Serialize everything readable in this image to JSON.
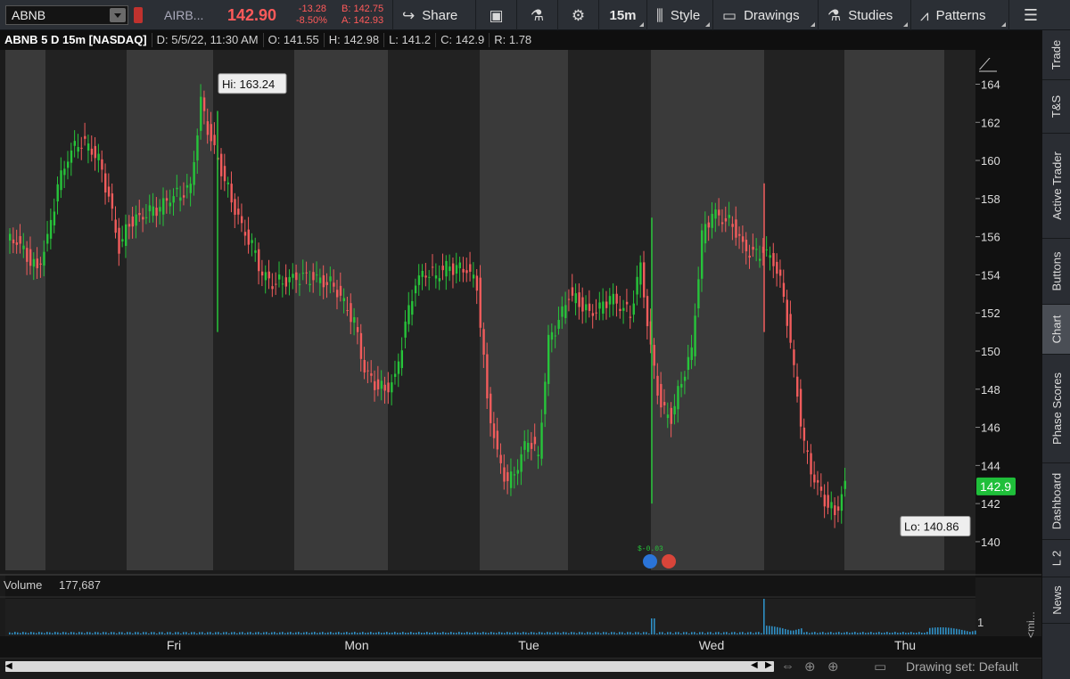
{
  "toolbar": {
    "symbol": "ABNB",
    "company": "AIRB...",
    "last": "142.90",
    "change": "-13.28",
    "change_pct": "-8.50%",
    "bid": "B: 142.75",
    "ask": "A: 142.93",
    "share": "Share",
    "timeframe": "15m",
    "style": "Style",
    "drawings": "Drawings",
    "studies": "Studies",
    "patterns": "Patterns"
  },
  "header": {
    "title": "ABNB 5 D 15m [NASDAQ]",
    "date": "D: 5/5/22, 11:30 AM",
    "open": "O: 141.55",
    "high": "H: 142.98",
    "low": "L: 141.2",
    "close": "C: 142.9",
    "range": "R: 1.78"
  },
  "annotations": {
    "hi": "Hi: 163.24",
    "lo": "Lo: 140.86",
    "price_tag": "142.9",
    "event_text": "$-0.03"
  },
  "volume": {
    "label": "Volume",
    "value": "177,687",
    "axis_tick": "1"
  },
  "sidepanel": [
    "Trade",
    "T&S",
    "Active Trader",
    "Buttons",
    "Chart",
    "Phase Scores",
    "Dashboard",
    "L 2",
    "News"
  ],
  "sidepanel_active": "Chart",
  "collapse_label": "<mi...",
  "footer": {
    "drawing_set": "Drawing set: Default"
  },
  "chart_data": {
    "type": "candlestick",
    "y_ticks": [
      140,
      142,
      144,
      146,
      148,
      150,
      152,
      154,
      156,
      158,
      160,
      162,
      164
    ],
    "ylim": [
      138.5,
      165.8
    ],
    "x_labels": [
      "Fri",
      "Mon",
      "Tue",
      "Wed",
      "Thu"
    ],
    "x": [
      0,
      3,
      6,
      9,
      12,
      15,
      18,
      21,
      24,
      27,
      30,
      33,
      36,
      39,
      42,
      45,
      48,
      51,
      54,
      57,
      60,
      63,
      66,
      69,
      72,
      75,
      78,
      81,
      84,
      87,
      90,
      93,
      96,
      99,
      102,
      105,
      108,
      111,
      114,
      117,
      120,
      123,
      126,
      129,
      132,
      135,
      138,
      141,
      144,
      147,
      150,
      153,
      156,
      159,
      162,
      165,
      168,
      171,
      174,
      177,
      180,
      183,
      186,
      189,
      192,
      195,
      198,
      201,
      204,
      207,
      210,
      213,
      216,
      219,
      222,
      225,
      228,
      231,
      234,
      237,
      240,
      243,
      246,
      249,
      252,
      255,
      258,
      261,
      264,
      267,
      270,
      273,
      276,
      279
    ],
    "close": [
      155.8,
      155.0,
      154.3,
      155.8,
      158.6,
      160.2,
      161.0,
      160.8,
      160.0,
      158.0,
      155.4,
      156.8,
      157.0,
      157.3,
      157.5,
      158.1,
      158.3,
      158.6,
      163.0,
      161.0,
      159.5,
      158.0,
      156.5,
      155.5,
      154.0,
      153.6,
      153.7,
      153.8,
      153.8,
      153.8,
      153.7,
      153.5,
      152.5,
      151.5,
      149.0,
      148.3,
      148.0,
      148.5,
      151.3,
      153.6,
      154.2,
      154.0,
      154.4,
      154.3,
      154.3,
      153.5,
      147.5,
      144.5,
      143.0,
      144.0,
      145.5,
      144.5,
      150.5,
      151.5,
      153.0,
      152.6,
      152.0,
      152.2,
      152.8,
      152.4,
      152.0,
      154.5,
      150.0,
      147.0,
      146.5,
      148.5,
      150.0,
      156.0,
      157.2,
      157.0,
      156.7,
      155.5,
      155.0,
      155.2,
      154.8,
      153.0,
      149.0,
      145.0,
      143.2,
      142.2,
      141.5,
      142.9
    ],
    "price_last": 142.9,
    "hi": 163.24,
    "lo": 140.86,
    "volume_spikes_at": [
      "Wed morning",
      "Wed session"
    ],
    "session_shading": "alternating gray"
  }
}
